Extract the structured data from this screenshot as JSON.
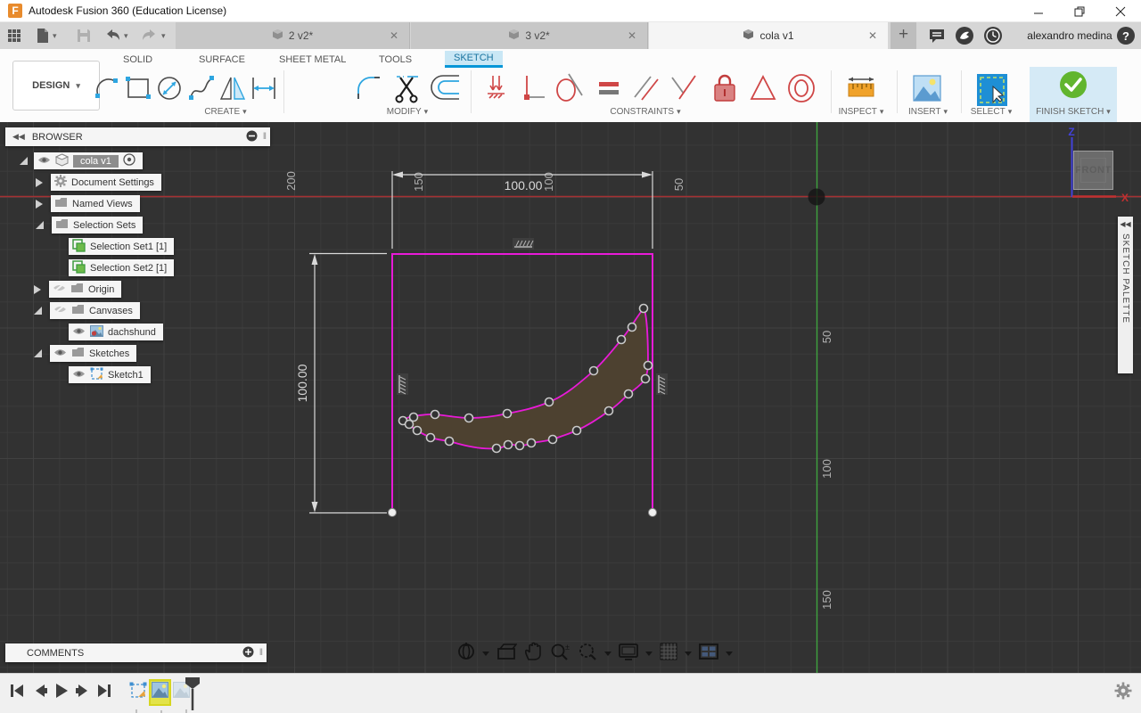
{
  "window": {
    "title": "Autodesk Fusion 360 (Education License)"
  },
  "tabbar": {
    "tabs": [
      {
        "label": "2 v2*"
      },
      {
        "label": "3 v2*"
      },
      {
        "label": "cola v1"
      }
    ],
    "user": "alexandro medina"
  },
  "ribbon": {
    "design": "DESIGN",
    "tabs": [
      "SOLID",
      "SURFACE",
      "SHEET METAL",
      "TOOLS",
      "SKETCH"
    ],
    "groups": {
      "create": "CREATE",
      "modify": "MODIFY",
      "constraints": "CONSTRAINTS",
      "inspect": "INSPECT",
      "insert": "INSERT",
      "select": "SELECT",
      "finish": "FINISH SKETCH"
    }
  },
  "browser": {
    "header": "BROWSER",
    "items": {
      "root": "cola v1",
      "doc_settings": "Document Settings",
      "named_views": "Named Views",
      "selection_sets": "Selection Sets",
      "set1": "Selection Set1 [1]",
      "set2": "Selection Set2 [1]",
      "origin": "Origin",
      "canvases": "Canvases",
      "dachshund": "dachshund",
      "sketches": "Sketches",
      "sketch1": "Sketch1"
    }
  },
  "canvas": {
    "dim_horizontal": "100.00",
    "dim_vertical": "100.00",
    "x_ticks": [
      "200",
      "150",
      "100",
      "50"
    ],
    "y_ticks": [
      "50",
      "100",
      "150"
    ],
    "viewcube_face": "FRONT",
    "axis_x_label": "X",
    "axis_z_label": "Z",
    "palette_title": "SKETCH PALETTE",
    "colors": {
      "sketch_line": "#e81ad8",
      "shape_fill": "#4d4130",
      "x_axis": "#a63032",
      "y_axis": "#3fa43f",
      "accent": "#0696d7"
    }
  },
  "comments": {
    "header": "COMMENTS"
  }
}
